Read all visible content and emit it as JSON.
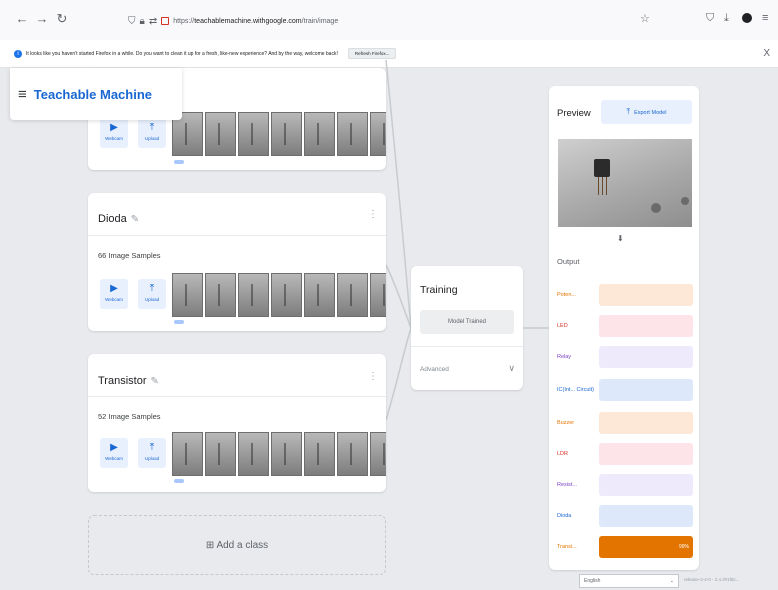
{
  "browser": {
    "back": "←",
    "forward": "→",
    "reload": "↻",
    "url_prefix": "https://",
    "url_host": "teachablemachine.withgoogle.com",
    "url_path": "/train/image",
    "star_icon": "☆",
    "shield_icon": "⛉",
    "download_icon": "⤓",
    "menu_icon": "≡"
  },
  "notification": {
    "message": "It looks like you haven't started Firefox in a while. Do you want to clean it up for a fresh, like-new experience? And by the way, welcome back!",
    "button_label": "Refresh Firefox...",
    "close": "X"
  },
  "app": {
    "menu_icon": "≡",
    "title": "Teachable Machine"
  },
  "classes": [
    {
      "name": "",
      "samples": "",
      "webcam": "Webcam",
      "upload": "Upload"
    },
    {
      "name": "Dioda",
      "samples": "66 Image Samples",
      "webcam": "Webcam",
      "upload": "Upload"
    },
    {
      "name": "Transistor",
      "samples": "52 Image Samples",
      "webcam": "Webcam",
      "upload": "Upload"
    }
  ],
  "add_class": "⊞ Add a class",
  "training": {
    "title": "Training",
    "button": "Model Trained",
    "advanced": "Advanced",
    "chevron": "∨"
  },
  "preview": {
    "title": "Preview",
    "export_icon": "⤒",
    "export_label": "Export Model",
    "output_label": "Output",
    "down_arrow": "⬇",
    "outputs": [
      {
        "label": "Poten...",
        "color": "#e37400",
        "bg": "#fde8d8",
        "value": 0,
        "pct": ""
      },
      {
        "label": "LED",
        "color": "#d93025",
        "bg": "#fce4e8",
        "value": 0,
        "pct": ""
      },
      {
        "label": "Relay",
        "color": "#7b3fc4",
        "bg": "#efeafb",
        "value": 0,
        "pct": ""
      },
      {
        "label": "IC(Int... Circuit)",
        "color": "#1967d2",
        "bg": "#dde8fb",
        "value": 0,
        "pct": ""
      },
      {
        "label": "Buzzer",
        "color": "#e37400",
        "bg": "#fde8d8",
        "value": 0,
        "pct": ""
      },
      {
        "label": "LDR",
        "color": "#d93025",
        "bg": "#fce4e8",
        "value": 0,
        "pct": ""
      },
      {
        "label": "Resist...",
        "color": "#7b3fc4",
        "bg": "#efeafb",
        "value": 0,
        "pct": ""
      },
      {
        "label": "Dioda",
        "color": "#1967d2",
        "bg": "#dde8fb",
        "value": 0,
        "pct": ""
      },
      {
        "label": "Transi...",
        "color": "#e37400",
        "bg": "#fde8d8",
        "value": 1,
        "pct": "99%"
      }
    ]
  },
  "footer": {
    "language": "English",
    "version": "release-2-4-0 - 2.4.3#1f8c..."
  }
}
